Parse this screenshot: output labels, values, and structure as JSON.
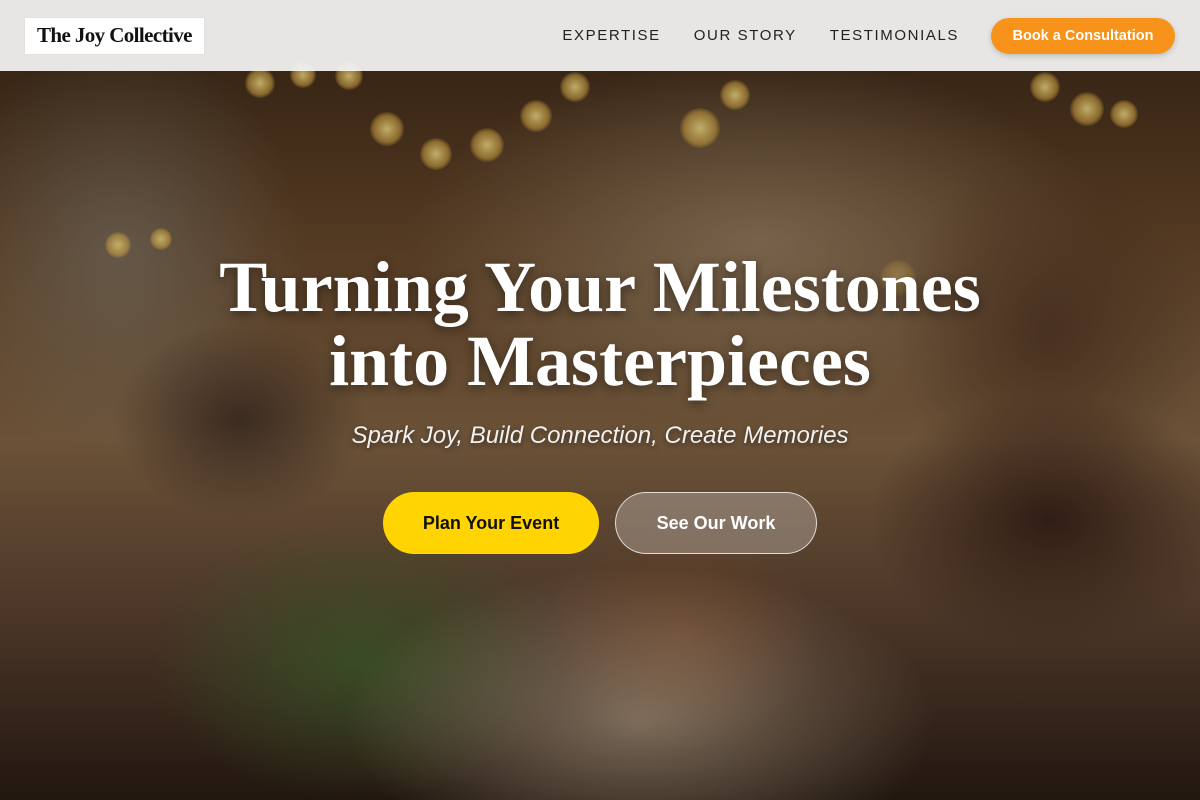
{
  "brand": {
    "name": "The Joy Collective"
  },
  "nav": {
    "links": [
      "EXPERTISE",
      "OUR STORY",
      "TESTIMONIALS"
    ],
    "cta_label": "Book a Consultation"
  },
  "hero": {
    "title_line1": "Turning Your Milestones",
    "title_line2": "into Masterpieces",
    "subtitle": "Spark Joy, Build Connection, Create Memories",
    "primary_button": "Plan Your Event",
    "secondary_button": "See Our Work",
    "background_image": "celebration-toast-photo"
  },
  "colors": {
    "accent_orange": "#f7931a",
    "accent_yellow": "#ffd400",
    "navbar_bg": "#f5f5f5"
  }
}
